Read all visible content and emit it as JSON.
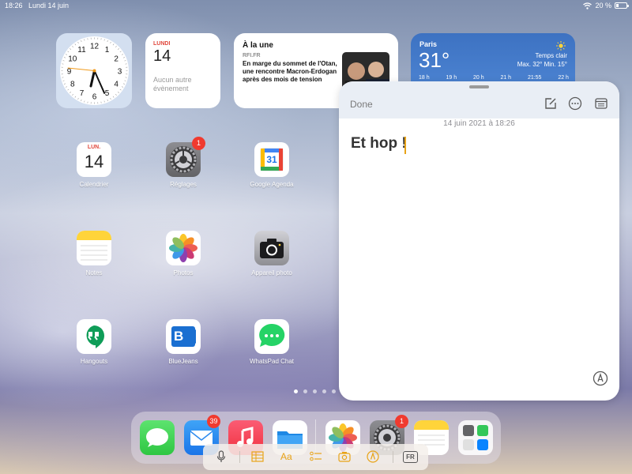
{
  "status_bar": {
    "time": "18:26",
    "date": "Lundi 14 juin",
    "battery": "20 %"
  },
  "clock_widget": {
    "hour": 6,
    "minute": 26,
    "second": 46
  },
  "calendar_widget": {
    "weekday": "LUNDI",
    "day": "14",
    "events": "Aucun autre évènement"
  },
  "news_widget": {
    "heading": "À la une",
    "source": "RFI.FR",
    "headline": "En marge du sommet de l'Otan, une rencontre Macron-Erdogan après des mois de tension"
  },
  "weather_widget": {
    "city": "Paris",
    "temperature": "31°",
    "condition": "Temps clair",
    "minmax": "Max. 32° Min. 15°",
    "hours": [
      "18 h",
      "19 h",
      "20 h",
      "21 h",
      "21:55",
      "22 h"
    ]
  },
  "apps": [
    {
      "label": "Calendrier",
      "icon": "calendar-icon",
      "icon_text_top": "LUN.",
      "icon_text_day": "14"
    },
    {
      "label": "Réglages",
      "icon": "settings-icon",
      "badge": "1"
    },
    {
      "label": "Google Agenda",
      "icon": "google-calendar-icon",
      "icon_text": "31"
    },
    {
      "label": "Notes",
      "icon": "notes-icon"
    },
    {
      "label": "Photos",
      "icon": "photos-icon"
    },
    {
      "label": "Appareil photo",
      "icon": "camera-icon"
    },
    {
      "label": "Hangouts",
      "icon": "hangouts-icon"
    },
    {
      "label": "BlueJeans",
      "icon": "bluejeans-icon",
      "icon_text": "B"
    },
    {
      "label": "WhatsPad Chat",
      "icon": "whatspad-icon"
    }
  ],
  "page_dots": {
    "count": 5,
    "active": 0
  },
  "dock": {
    "apps": [
      {
        "name": "messages-icon"
      },
      {
        "name": "mail-icon",
        "badge": "39"
      },
      {
        "name": "music-icon"
      },
      {
        "name": "files-icon"
      },
      {
        "name": "photos-icon"
      },
      {
        "name": "settings-icon",
        "badge": "1"
      },
      {
        "name": "notes-icon"
      },
      {
        "name": "app-library-icon"
      }
    ]
  },
  "notes_panel": {
    "done_label": "Done",
    "timestamp": "14 juin 2021 à 18:26",
    "title": "Et hop !"
  },
  "quicktype_bar": {
    "format_label": "Aa",
    "language_label": "FR"
  },
  "colors": {
    "accent_yellow": "#e8a317",
    "badge_red": "#f03a2f",
    "weather_blue": "#3d72c2"
  }
}
